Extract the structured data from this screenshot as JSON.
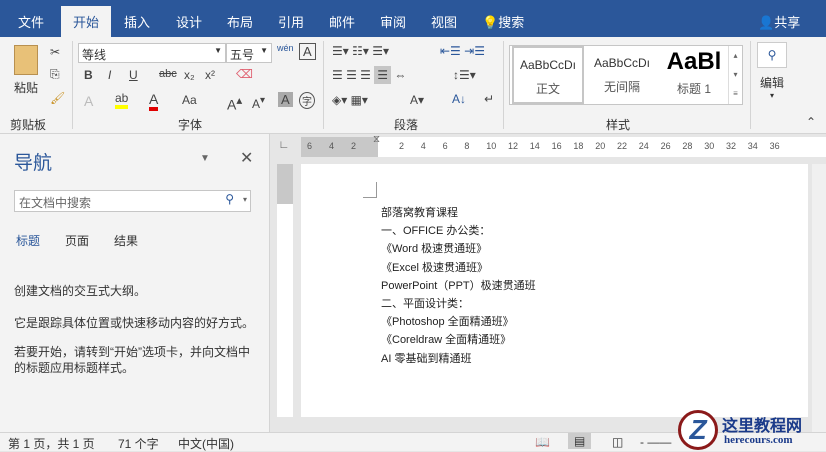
{
  "tabs": [
    "文件",
    "开始",
    "插入",
    "设计",
    "布局",
    "引用",
    "邮件",
    "审阅",
    "视图"
  ],
  "search_tab": "搜索",
  "share": "共享",
  "ribbon": {
    "paste": "粘贴",
    "clipboard": "剪贴板",
    "font_name": "等线",
    "font_size": "五号",
    "font_group": "字体",
    "paragraph_group": "段落",
    "styles_group": "样式",
    "edit": "编辑",
    "phonetic": "wén",
    "bold": "B",
    "italic": "I",
    "underline": "U",
    "strike": "abc",
    "sub": "x₂",
    "sup": "x²",
    "case": "Aa",
    "styles": [
      {
        "preview": "AaBbCcDı",
        "name": "正文"
      },
      {
        "preview": "AaBbCcDı",
        "name": "无间隔"
      },
      {
        "preview": "AaBl",
        "name": "标题 1"
      }
    ]
  },
  "nav": {
    "title": "导航",
    "search_placeholder": "在文档中搜索",
    "tabs": [
      "标题",
      "页面",
      "结果"
    ],
    "text1": "创建文档的交互式大纲。",
    "text2": "它是跟踪具体位置或快速移动内容的好方式。",
    "text3": "若要开始，请转到“开始”选项卡，并向文档中的标题应用标题样式。"
  },
  "ruler": {
    "left": [
      "6",
      "4",
      "2"
    ],
    "right": [
      "2",
      "4",
      "6",
      "8",
      "10",
      "12",
      "14",
      "16",
      "18",
      "20",
      "22",
      "24",
      "26",
      "28",
      "30",
      "32",
      "34",
      "36"
    ]
  },
  "document": {
    "lines": [
      "部落窝教育课程",
      "一、OFFICE 办公类：",
      "《Word 极速贯通班》",
      "《Excel 极速贯通班》",
      "PowerPoint（PPT）极速贯通班",
      "二、平面设计类：",
      "《Photoshop 全面精通班》",
      "《Coreldraw 全面精通班》",
      "AI 零基础到精通班"
    ]
  },
  "status": {
    "page": "第 1 页，共 1 页",
    "words": "71 个字",
    "lang": "中文(中国)"
  },
  "watermark": {
    "title": "这里教程网",
    "url": "herecours.com"
  },
  "colors": {
    "brand": "#2b579a"
  }
}
